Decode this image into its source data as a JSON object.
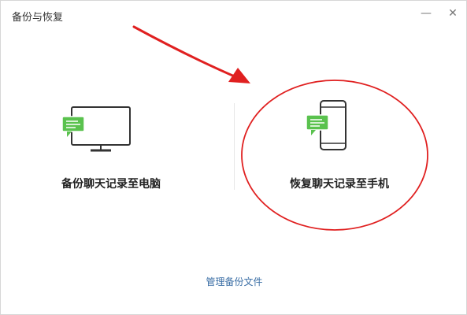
{
  "window": {
    "title": "备份与恢复",
    "minimize_symbol": "—",
    "close_symbol": "✕"
  },
  "options": {
    "backup_label": "备份聊天记录至电脑",
    "restore_label": "恢复聊天记录至手机"
  },
  "footer": {
    "manage_link": "管理备份文件"
  },
  "colors": {
    "accent_green": "#5ac24e",
    "link_blue": "#3a6ea5",
    "annotation_red": "#e02020"
  },
  "icons": {
    "backup": "monitor-with-chat-icon",
    "restore": "phone-with-chat-icon"
  }
}
